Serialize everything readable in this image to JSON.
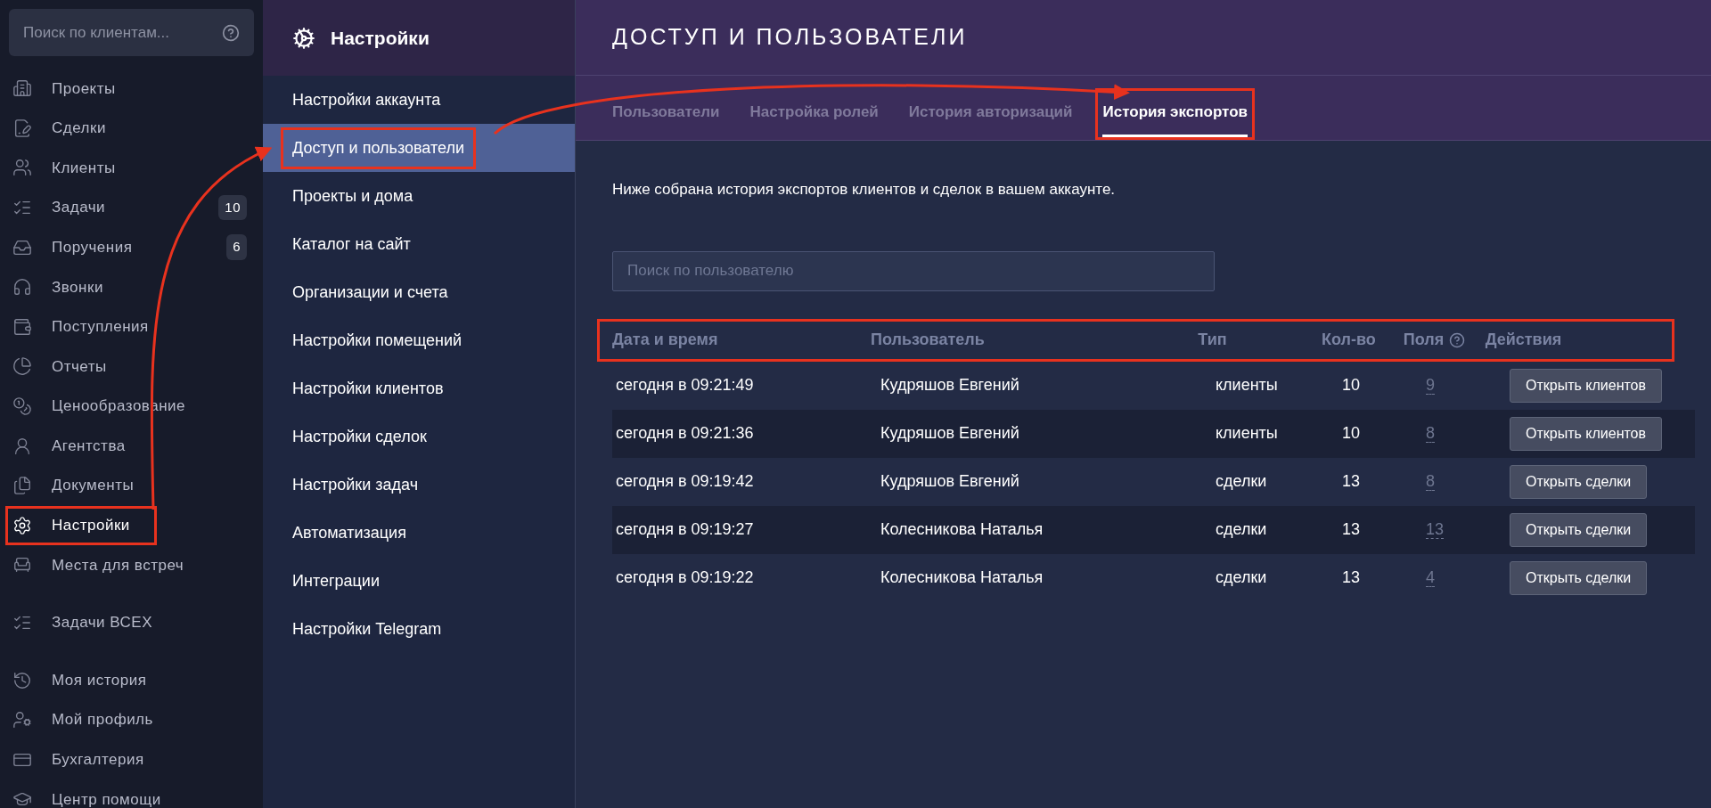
{
  "sidebar": {
    "search": {
      "placeholder": "Поиск по клиентам..."
    },
    "groups": [
      [
        {
          "label": "Проекты",
          "selected": false,
          "highlighted": false
        },
        {
          "label": "Сделки",
          "selected": false,
          "highlighted": false
        },
        {
          "label": "Клиенты",
          "selected": false,
          "highlighted": false
        },
        {
          "label": "Задачи",
          "badge": "10",
          "selected": false,
          "highlighted": false
        },
        {
          "label": "Поручения",
          "badge": "6",
          "selected": false,
          "highlighted": false
        },
        {
          "label": "Звонки",
          "selected": false,
          "highlighted": false
        },
        {
          "label": "Поступления",
          "selected": false,
          "highlighted": false
        },
        {
          "label": "Отчеты",
          "selected": false,
          "highlighted": false
        },
        {
          "label": "Ценообразование",
          "selected": false,
          "highlighted": false
        },
        {
          "label": "Агентства",
          "selected": false,
          "highlighted": false
        },
        {
          "label": "Документы",
          "selected": false,
          "highlighted": false
        },
        {
          "label": "Настройки",
          "selected": true,
          "highlighted": true
        },
        {
          "label": "Места для встреч",
          "selected": false,
          "highlighted": false
        }
      ],
      [
        {
          "label": "Задачи ВСЕХ",
          "selected": false,
          "highlighted": false
        }
      ],
      [
        {
          "label": "Моя история",
          "selected": false,
          "highlighted": false
        },
        {
          "label": "Мой профиль",
          "selected": false,
          "highlighted": false
        },
        {
          "label": "Бухгалтерия",
          "selected": false,
          "highlighted": false
        },
        {
          "label": "Центр помощи",
          "selected": false,
          "highlighted": false
        }
      ]
    ]
  },
  "settings": {
    "title": "Настройки",
    "items": [
      {
        "label": "Настройки аккаунта",
        "selected": false,
        "highlighted": false
      },
      {
        "label": "Доступ и пользователи",
        "selected": true,
        "highlighted": true
      },
      {
        "label": "Проекты и дома",
        "selected": false,
        "highlighted": false
      },
      {
        "label": "Каталог на сайт",
        "selected": false,
        "highlighted": false
      },
      {
        "label": "Организации и счета",
        "selected": false,
        "highlighted": false
      },
      {
        "label": "Настройки помещений",
        "selected": false,
        "highlighted": false
      },
      {
        "label": "Настройки клиентов",
        "selected": false,
        "highlighted": false
      },
      {
        "label": "Настройки сделок",
        "selected": false,
        "highlighted": false
      },
      {
        "label": "Настройки задач",
        "selected": false,
        "highlighted": false
      },
      {
        "label": "Автоматизация",
        "selected": false,
        "highlighted": false
      },
      {
        "label": "Интеграции",
        "selected": false,
        "highlighted": false
      },
      {
        "label": "Настройки Telegram",
        "selected": false,
        "highlighted": false
      }
    ]
  },
  "main": {
    "title": "ДОСТУП И ПОЛЬЗОВАТЕЛИ",
    "tabs": [
      {
        "label": "Пользователи",
        "selected": false,
        "highlighted": false
      },
      {
        "label": "Настройка ролей",
        "selected": false,
        "highlighted": false
      },
      {
        "label": "История авторизаций",
        "selected": false,
        "highlighted": false
      },
      {
        "label": "История экспортов",
        "selected": true,
        "highlighted": true
      }
    ],
    "description": "Ниже собрана история экспортов клиентов и сделок в вашем аккаунте.",
    "search": {
      "placeholder": "Поиск по пользователю"
    },
    "table": {
      "header_highlighted": true,
      "columns": [
        {
          "label": "Дата и время",
          "help": false
        },
        {
          "label": "Пользователь",
          "help": false
        },
        {
          "label": "Тип",
          "help": false
        },
        {
          "label": "Кол-во",
          "help": false
        },
        {
          "label": "Поля",
          "help": true
        },
        {
          "label": "Действия",
          "help": false
        }
      ],
      "rows": [
        {
          "date": "сегодня в 09:21:49",
          "user": "Кудряшов Евгений",
          "type": "клиенты",
          "count": "10",
          "fields": "9",
          "action": "Открыть клиентов"
        },
        {
          "date": "сегодня в 09:21:36",
          "user": "Кудряшов Евгений",
          "type": "клиенты",
          "count": "10",
          "fields": "8",
          "action": "Открыть клиентов"
        },
        {
          "date": "сегодня в 09:19:42",
          "user": "Кудряшов Евгений",
          "type": "сделки",
          "count": "13",
          "fields": "8",
          "action": "Открыть сделки"
        },
        {
          "date": "сегодня в 09:19:27",
          "user": "Колесникова Наталья",
          "type": "сделки",
          "count": "13",
          "fields": "13",
          "action": "Открыть сделки"
        },
        {
          "date": "сегодня в 09:19:22",
          "user": "Колесникова Наталья",
          "type": "сделки",
          "count": "13",
          "fields": "4",
          "action": "Открыть сделки"
        }
      ]
    }
  }
}
